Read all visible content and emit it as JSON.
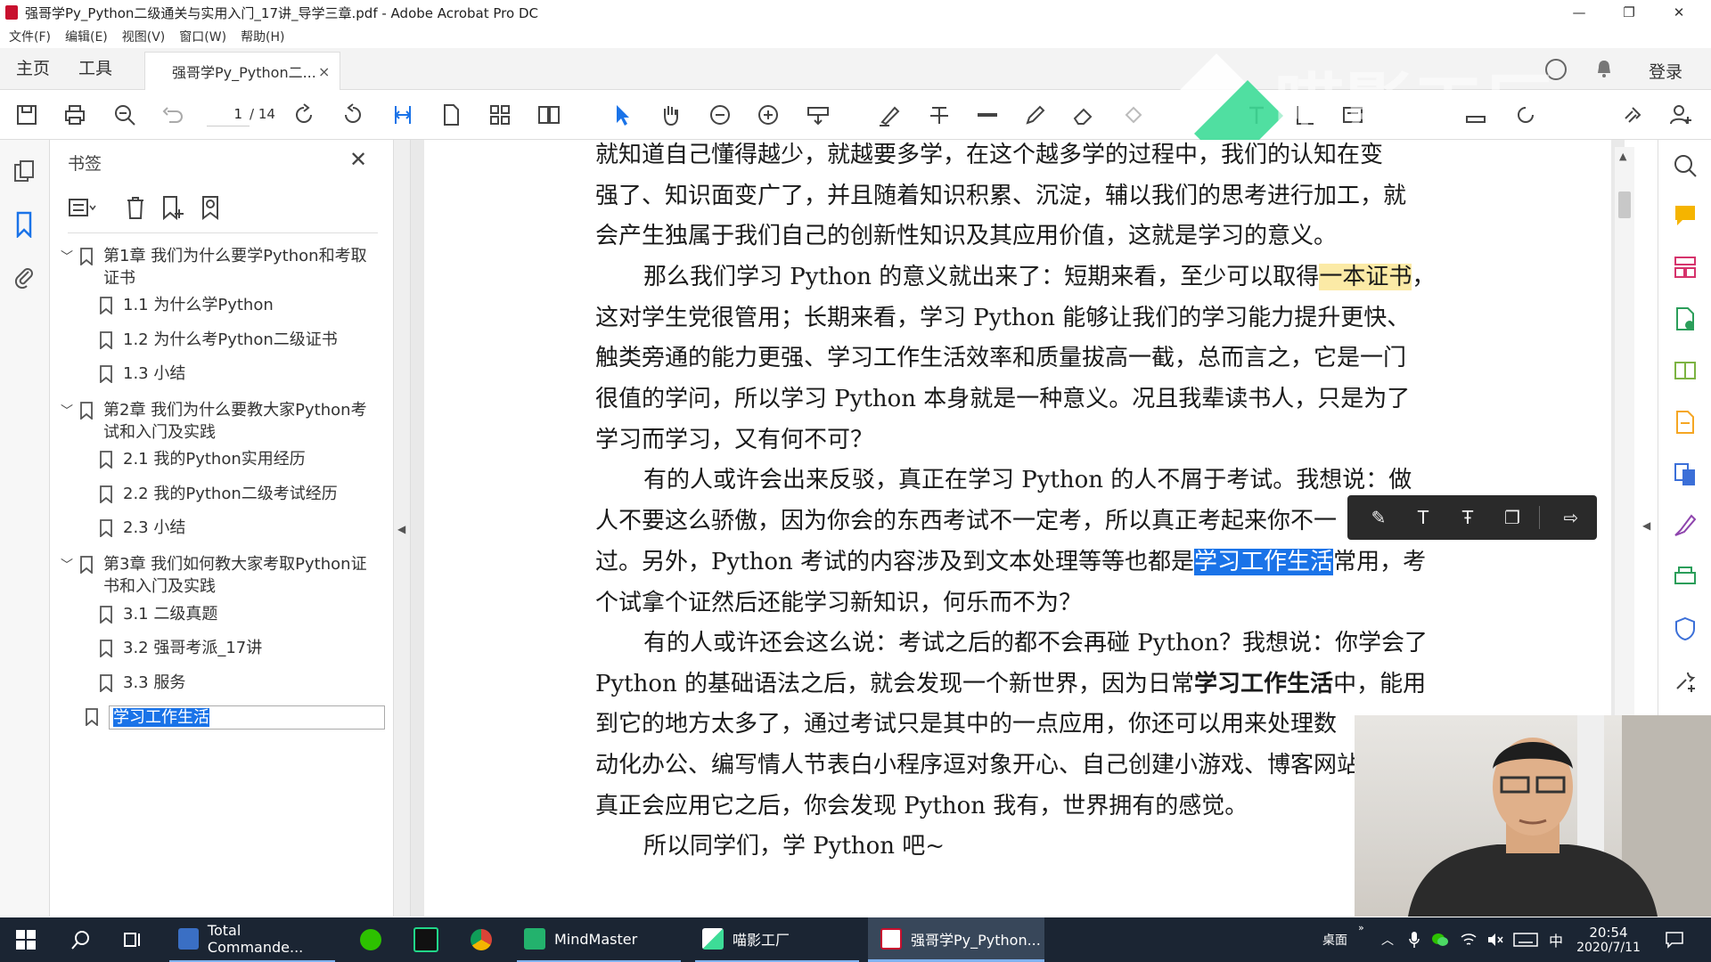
{
  "window": {
    "title": "强哥学Py_Python二级通关与实用入门_17讲_导学三章.pdf - Adobe Acrobat Pro DC"
  },
  "menu": [
    "文件(F)",
    "编辑(E)",
    "视图(V)",
    "窗口(W)",
    "帮助(H)"
  ],
  "tabs": {
    "home": "主页",
    "tools": "工具",
    "document": "强哥学Py_Python二...",
    "close": "×"
  },
  "header_right": {
    "login": "登录"
  },
  "toolbar": {
    "current_page": "1",
    "total_pages": "/ 14"
  },
  "bookmarks": {
    "title": "书签",
    "close": "✕",
    "items": [
      {
        "level": 1,
        "expanded": true,
        "label": "第1章 我们为什么要学Python和考取证书"
      },
      {
        "level": 2,
        "label": "1.1 为什么学Python"
      },
      {
        "level": 2,
        "label": "1.2 为什么考Python二级证书"
      },
      {
        "level": 2,
        "label": "1.3 小结"
      },
      {
        "level": 1,
        "expanded": true,
        "label": "第2章 我们为什么要教大家Python考试和入门及实践"
      },
      {
        "level": 2,
        "label": "2.1 我的Python实用经历"
      },
      {
        "level": 2,
        "label": "2.2 我的Python二级考试经历"
      },
      {
        "level": 2,
        "label": "2.3 小结"
      },
      {
        "level": 1,
        "expanded": true,
        "label": "第3章 我们如何教大家考取Python证书和入门及实践"
      },
      {
        "level": 2,
        "label": "3.1 二级真题"
      },
      {
        "level": 2,
        "label": "3.2 强哥考派_17讲"
      },
      {
        "level": 2,
        "label": "3.3 服务"
      },
      {
        "level": 1,
        "selected": true,
        "label": "学习工作生活"
      }
    ]
  },
  "document": {
    "lines": [
      {
        "text": "就知道自己懂得越少，就越要多学，在这个越多学的过程中，我们的认知在变"
      },
      {
        "text": "强了、知识面变广了，并且随着知识积累、沉淀，辅以我们的思考进行加工，就"
      },
      {
        "text": "会产生独属于我们自己的创新性知识及其应用价值，这就是学习的意义。"
      },
      {
        "pre": "那么我们学习 Python 的意义就出来了：短期来看，至少可以取得",
        "highlight": "一本证书",
        "post": "，",
        "indent": true
      },
      {
        "text": "这对学生党很管用；长期来看，学习 Python 能够让我们的学习能力提升更快、"
      },
      {
        "text": "触类旁通的能力更强、学习工作生活效率和质量拔高一截，总而言之，它是一门"
      },
      {
        "text": "很值的学问，所以学习 Python 本身就是一种意义。况且我辈读书人，只是为了"
      },
      {
        "text": "学习而学习，又有何不可？"
      },
      {
        "text": "有的人或许会出来反驳，真正在学习 Python 的人不屑于考试。我想说：做",
        "indent": true
      },
      {
        "text": "人不要这么骄傲，因为你会的东西考试不一定考，所以真正考起来你不一"
      },
      {
        "pre": "过。另外，Python 考试的内容涉及到文本处理等等也都是",
        "selection": "学习工作生活",
        "post": "常用，考"
      },
      {
        "text": "个试拿个证然后还能学习新知识，何乐而不为？"
      },
      {
        "text": "有的人或许还会这么说：考试之后的都不会再碰 Python？我想说：你学会了",
        "indent": true
      },
      {
        "pre": "Python 的基础语法之后，就会发现一个新世界，因为日常",
        "bold": "学习工作生活",
        "post": "中，能用"
      },
      {
        "text": "到它的地方太多了，通过考试只是其中的一点应用，你还可以用来处理数"
      },
      {
        "text": "动化办公、编写情人节表白小程序逗对象开心、自己创建小游戏、博客网站"
      },
      {
        "text": "真正会应用它之后，你会发现 Python 我有，世界拥有的感觉。"
      },
      {
        "text": "所以同学们，学 Python 吧~",
        "indent": true
      }
    ]
  },
  "watermark": {
    "text": "喵影工厂"
  },
  "taskbar": {
    "apps": [
      {
        "label": "Total Commande...",
        "icon": "total-commander-icon"
      },
      {
        "label": "",
        "icon": "wechat-icon"
      },
      {
        "label": "",
        "icon": "pycharm-icon"
      },
      {
        "label": "",
        "icon": "chrome-icon"
      },
      {
        "label": "MindMaster",
        "icon": "mindmaster-icon"
      },
      {
        "label": "喵影工厂",
        "icon": "filmora-icon"
      },
      {
        "label": "强哥学Py_Python...",
        "icon": "acrobat-icon"
      }
    ],
    "desktop": "桌面",
    "ime": "中",
    "time": "20:54",
    "date": "2020/7/11"
  },
  "colors": {
    "accent": "#1a73e8",
    "highlight_yellow": "#fbeaa6",
    "taskbar": "#1b2533"
  }
}
